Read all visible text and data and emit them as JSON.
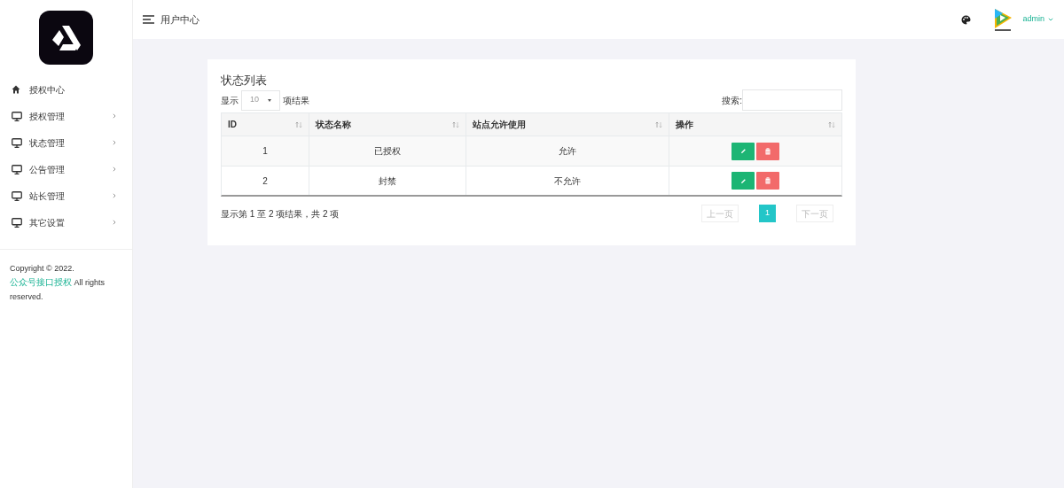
{
  "sidebar": {
    "items": [
      {
        "kind": "home",
        "label": "授权中心",
        "has_submenu": false
      },
      {
        "kind": "monitor",
        "label": "授权管理",
        "has_submenu": true
      },
      {
        "kind": "monitor",
        "label": "状态管理",
        "has_submenu": true
      },
      {
        "kind": "monitor",
        "label": "公告管理",
        "has_submenu": true
      },
      {
        "kind": "monitor",
        "label": "站长管理",
        "has_submenu": true
      },
      {
        "kind": "monitor",
        "label": "其它设置",
        "has_submenu": true
      }
    ],
    "footer": {
      "prefix": "Copyright © 2022.",
      "link": "公众号接口授权",
      "suffix": "All rights reserved."
    }
  },
  "header": {
    "title": "用户中心",
    "user": "admin"
  },
  "card": {
    "title": "状态列表",
    "length_prefix": "显示",
    "length_value": "10",
    "length_suffix": "项结果",
    "search_label": "搜索:",
    "table": {
      "columns": [
        {
          "label": "ID"
        },
        {
          "label": "状态名称"
        },
        {
          "label": "站点允许使用"
        },
        {
          "label": "操作"
        }
      ],
      "rows": [
        {
          "id": "1",
          "name": "已授权",
          "allowed": "允许"
        },
        {
          "id": "2",
          "name": "封禁",
          "allowed": "不允许"
        }
      ]
    },
    "info": "显示第 1 至 2 项结果，共 2 项",
    "pagination": {
      "prev": {
        "label": "上一页",
        "disabled": true
      },
      "pages": [
        {
          "label": "1",
          "selected": true
        }
      ],
      "next": {
        "label": "下一页",
        "disabled": true
      }
    }
  }
}
